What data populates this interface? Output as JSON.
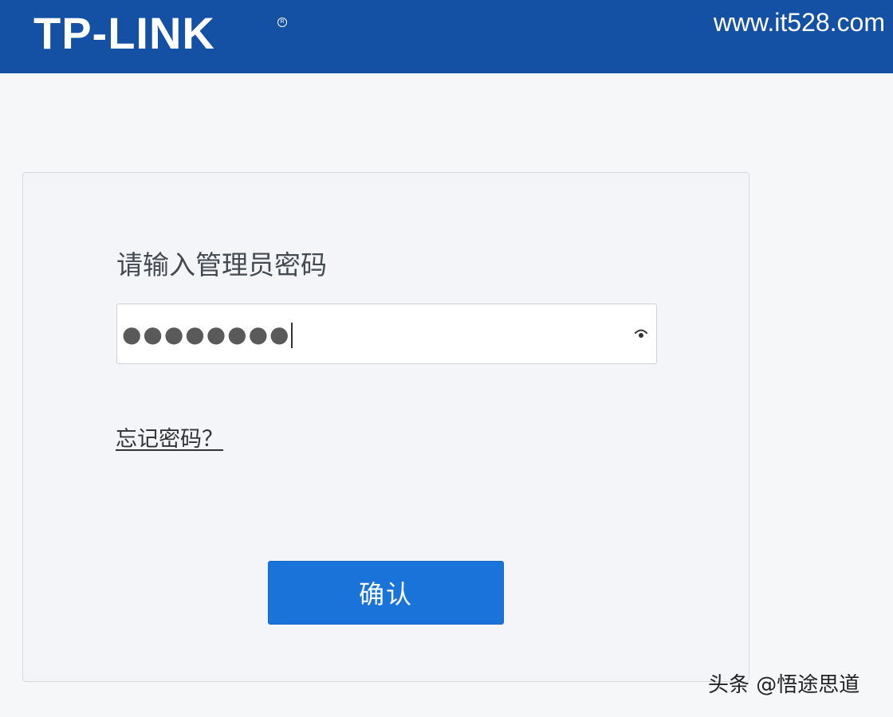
{
  "header": {
    "logo_text": "TP-LINK",
    "site_url": "www.it528.com",
    "background_color": "#1450a3"
  },
  "login": {
    "prompt": "请输入管理员密码",
    "password_value": "●●●●●●●●",
    "password_toggle_icon": "eye-icon",
    "forgot_link": "忘记密码？",
    "confirm_label": "确认",
    "confirm_color": "#1a73d9"
  },
  "watermark": {
    "text": "头条 @悟途思道"
  }
}
